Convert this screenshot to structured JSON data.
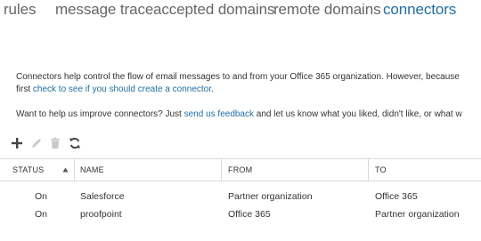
{
  "tabs": [
    {
      "label": "rules"
    },
    {
      "label": "message trace"
    },
    {
      "label": "accepted domains"
    },
    {
      "label": "remote domains"
    },
    {
      "label": "connectors"
    }
  ],
  "description": {
    "line1": "Connectors help control the flow of email messages to and from your Office 365 organization. However, because",
    "line2_prefix": "first ",
    "line2_link": "check to see if you should create a connector",
    "line2_suffix": ".",
    "feedback_prefix": "Want to help us improve connectors? Just ",
    "feedback_link": "send us feedback",
    "feedback_suffix": " and let us know what you liked, didn't like, or what w"
  },
  "toolbar": {
    "icons": [
      "add-icon",
      "edit-icon",
      "delete-icon",
      "refresh-icon"
    ]
  },
  "table": {
    "columns": [
      "STATUS",
      "NAME",
      "FROM",
      "TO"
    ],
    "sorted_column": "STATUS",
    "rows": [
      {
        "status": "On",
        "name": "Salesforce",
        "from": "Partner organization",
        "to": "Office 365"
      },
      {
        "status": "On",
        "name": "proofpoint",
        "from": "Office 365",
        "to": "Partner organization"
      }
    ]
  },
  "colors": {
    "active_tab": "#1e6ea6",
    "link": "#1e6ea6",
    "inactive_tab": "#666666",
    "text": "#333333"
  }
}
